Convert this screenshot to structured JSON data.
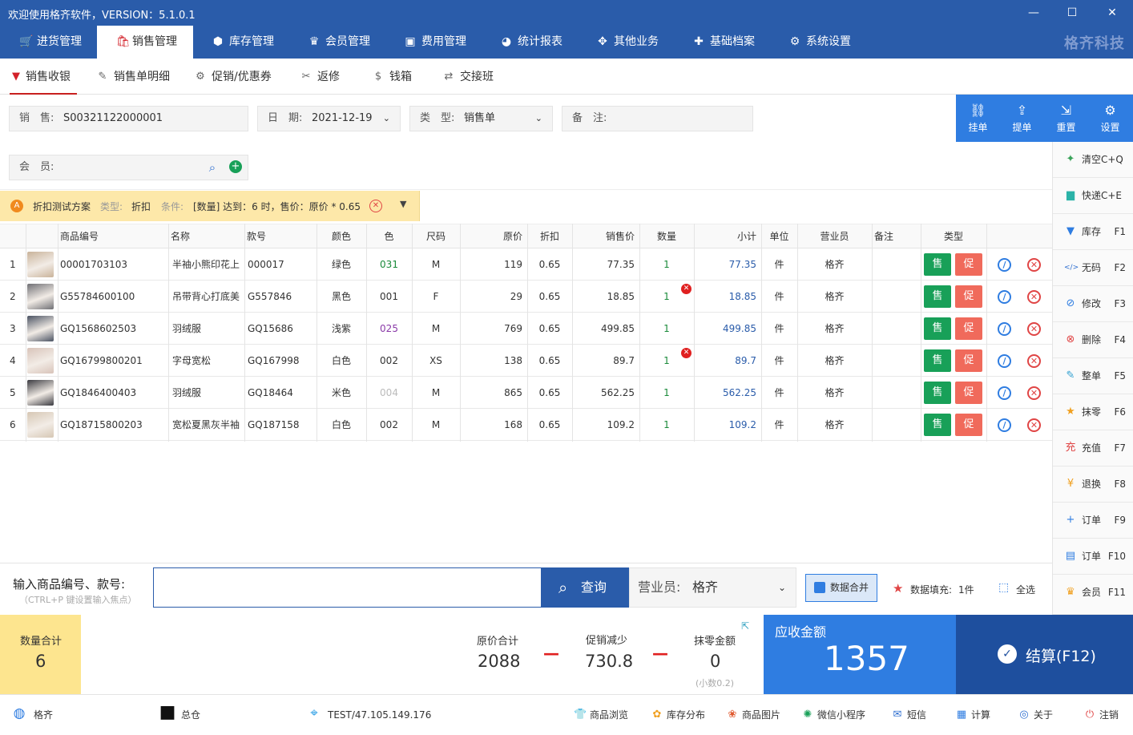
{
  "window": {
    "title": "欢迎使用格齐软件，VERSION：5.1.0.1",
    "min": "—",
    "max": "☐",
    "close": "✕"
  },
  "menu": [
    {
      "label": "进货管理",
      "icon": "cart-icon",
      "glyph": "🛒"
    },
    {
      "label": "销售管理",
      "icon": "bag-icon",
      "glyph": "🛍"
    },
    {
      "label": "库存管理",
      "icon": "cube-icon",
      "glyph": "⬢"
    },
    {
      "label": "会员管理",
      "icon": "crown-icon",
      "glyph": "♛"
    },
    {
      "label": "费用管理",
      "icon": "wallet-icon",
      "glyph": "▣"
    },
    {
      "label": "统计报表",
      "icon": "pie-icon",
      "glyph": "◕"
    },
    {
      "label": "其他业务",
      "icon": "grid-icon",
      "glyph": "✥"
    },
    {
      "label": "基础档案",
      "icon": "puzzle-icon",
      "glyph": "✚"
    },
    {
      "label": "系统设置",
      "icon": "gear-icon",
      "glyph": "⚙"
    }
  ],
  "brand": "格齐科技",
  "subnav": [
    {
      "label": "销售收银",
      "glyph": "▼"
    },
    {
      "label": "销售单明细",
      "glyph": "✎"
    },
    {
      "label": "促销/优惠券",
      "glyph": "⚙"
    },
    {
      "label": "返修",
      "glyph": "✂"
    },
    {
      "label": "钱箱",
      "glyph": "$"
    },
    {
      "label": "交接班",
      "glyph": "⇄"
    }
  ],
  "form": {
    "sale_label": "销　售:",
    "sale_value": "S00321122000001",
    "date_label": "日　期:",
    "date_value": "2021-12-19",
    "type_label": "类　型:",
    "type_value": "销售单",
    "note_label": "备　注:",
    "note_value": "",
    "member_label": "会　员:"
  },
  "actions": [
    {
      "label": "挂单",
      "glyph": "⛓"
    },
    {
      "label": "提单",
      "glyph": "⇪"
    },
    {
      "label": "重置",
      "glyph": "⇲"
    },
    {
      "label": "设置",
      "glyph": "⚙"
    }
  ],
  "promo": {
    "name": "折扣测试方案",
    "type_label": "类型:",
    "type_value": "折扣",
    "cond_label": "条件:",
    "cond_value": "[数量] 达到：6 时，售价：原价 * 0.65"
  },
  "table": {
    "headers": [
      "商品编号",
      "名称",
      "款号",
      "颜色",
      "色",
      "尺码",
      "原价",
      "折扣",
      "销售价",
      "数量",
      "小计",
      "单位",
      "营业员",
      "备注",
      "类型"
    ],
    "rows": [
      {
        "idx": "1",
        "code": "00001703103",
        "name": "半袖小熊印花上",
        "style": "000017",
        "color": "绿色",
        "cc": "031",
        "cc_color": "#1a8a3a",
        "size": "M",
        "price": "119",
        "disc": "0.65",
        "sale": "77.35",
        "qty": "1",
        "sub": "77.35",
        "unit": "件",
        "clerk": "格齐",
        "badge": false,
        "thumb": "#c9b39a"
      },
      {
        "idx": "2",
        "code": "G55784600100",
        "name": "吊带背心打底美",
        "style": "G557846",
        "color": "黑色",
        "cc": "001",
        "cc_color": "#333333",
        "size": "F",
        "price": "29",
        "disc": "0.65",
        "sale": "18.85",
        "qty": "1",
        "sub": "18.85",
        "unit": "件",
        "clerk": "格齐",
        "badge": true,
        "thumb": "#6f6f74"
      },
      {
        "idx": "3",
        "code": "GQ1568602503",
        "name": "羽绒服",
        "style": "GQ15686",
        "color": "浅紫",
        "cc": "025",
        "cc_color": "#8a3aa8",
        "size": "M",
        "price": "769",
        "disc": "0.65",
        "sale": "499.85",
        "qty": "1",
        "sub": "499.85",
        "unit": "件",
        "clerk": "格齐",
        "badge": false,
        "thumb": "#4a5262"
      },
      {
        "idx": "4",
        "code": "GQ16799800201",
        "name": "字母宽松",
        "style": "GQ167998",
        "color": "白色",
        "cc": "002",
        "cc_color": "#333333",
        "size": "XS",
        "price": "138",
        "disc": "0.65",
        "sale": "89.7",
        "qty": "1",
        "sub": "89.7",
        "unit": "件",
        "clerk": "格齐",
        "badge": true,
        "thumb": "#d8c3b9"
      },
      {
        "idx": "5",
        "code": "GQ1846400403",
        "name": "羽绒服",
        "style": "GQ18464",
        "color": "米色",
        "cc": "004",
        "cc_color": "#bbbbbb",
        "size": "M",
        "price": "865",
        "disc": "0.65",
        "sale": "562.25",
        "qty": "1",
        "sub": "562.25",
        "unit": "件",
        "clerk": "格齐",
        "badge": false,
        "thumb": "#3a3a40"
      },
      {
        "idx": "6",
        "code": "GQ18715800203",
        "name": "宽松夏黑灰半袖",
        "style": "GQ187158",
        "color": "白色",
        "cc": "002",
        "cc_color": "#333333",
        "size": "M",
        "price": "168",
        "disc": "0.65",
        "sale": "109.2",
        "qty": "1",
        "sub": "109.2",
        "unit": "件",
        "clerk": "格齐",
        "badge": false,
        "thumb": "#d6c7b4"
      }
    ],
    "sell": "售",
    "promo": "促",
    "badge_glyph": "✕"
  },
  "shortcuts": [
    {
      "label": "清空C+Q",
      "key": "",
      "glyph": "✦",
      "color": "#3aa35a"
    },
    {
      "label": "快递C+E",
      "key": "",
      "glyph": "▆",
      "color": "#2bb3a8"
    },
    {
      "label": "库存",
      "key": "F1",
      "glyph": "▼",
      "color": "#2f7de1"
    },
    {
      "label": "无码",
      "key": "F2",
      "glyph": "</>",
      "color": "#2f6fd0"
    },
    {
      "label": "修改",
      "key": "F3",
      "glyph": "⊘",
      "color": "#2f7de1"
    },
    {
      "label": "删除",
      "key": "F4",
      "glyph": "⊗",
      "color": "#e04545"
    },
    {
      "label": "整单",
      "key": "F5",
      "glyph": "✎",
      "color": "#2f9fd0"
    },
    {
      "label": "抹零",
      "key": "F6",
      "glyph": "★",
      "color": "#f0a020"
    },
    {
      "label": "充值",
      "key": "F7",
      "glyph": "充",
      "color": "#e04545"
    },
    {
      "label": "退换",
      "key": "F8",
      "glyph": "¥",
      "color": "#f0a020"
    },
    {
      "label": "订单",
      "key": "F9",
      "glyph": "+",
      "color": "#2f7de1"
    },
    {
      "label": "订单",
      "key": "F10",
      "glyph": "▤",
      "color": "#2f7de1"
    },
    {
      "label": "会员",
      "key": "F11",
      "glyph": "♛",
      "color": "#f0a020"
    }
  ],
  "input": {
    "label": "输入商品编号、款号:",
    "hint": "（CTRL+P 键设置输入焦点）",
    "value": "",
    "query": "查询",
    "clerk_label": "营业员:",
    "clerk_value": "格齐",
    "merge": "数据合并",
    "fill_label": "数据填充:",
    "fill_value": "1件",
    "select_all": "全选"
  },
  "totals": {
    "qty_label": "数量合计",
    "qty": "6",
    "orig_label": "原价合计",
    "orig": "2088",
    "promo_label": "促销减少",
    "promo": "730.8",
    "round_label": "抹零金额",
    "round": "0",
    "round_hint": "(小数0.2)",
    "due_label": "应收金额",
    "due": "1357",
    "pay": "结算(F12)",
    "minus": "—"
  },
  "status": [
    {
      "label": "格齐",
      "glyph": "◍",
      "color": "#2f7de1"
    },
    {
      "label": "总仓",
      "glyph": "■",
      "color": "#111111"
    },
    {
      "label": "TEST/47.105.149.176",
      "glyph": "⌖",
      "color": "#2fa0e6"
    },
    {
      "label": "商品浏览",
      "glyph": "👕",
      "color": "#e04545"
    },
    {
      "label": "库存分布",
      "glyph": "✿",
      "color": "#f0a020"
    },
    {
      "label": "商品图片",
      "glyph": "❀",
      "color": "#e05a30"
    },
    {
      "label": "微信小程序",
      "glyph": "✺",
      "color": "#18a058"
    },
    {
      "label": "短信",
      "glyph": "✉",
      "color": "#2f6fd0"
    },
    {
      "label": "计算",
      "glyph": "▦",
      "color": "#2f7de1"
    },
    {
      "label": "关于",
      "glyph": "◎",
      "color": "#2f6fd0"
    },
    {
      "label": "注销",
      "glyph": "⏻",
      "color": "#e04545"
    }
  ]
}
